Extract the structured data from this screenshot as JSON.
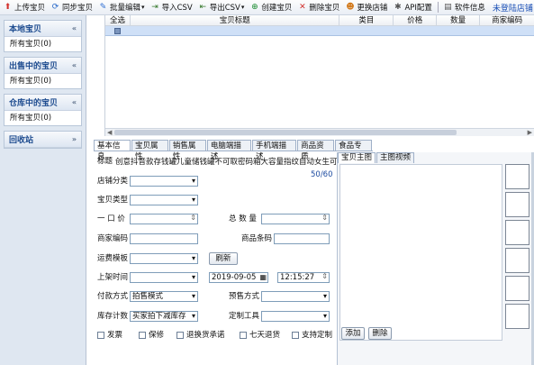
{
  "toolbar": {
    "buttons": [
      {
        "label": "上传宝贝",
        "icon": "upload-arrow-icon"
      },
      {
        "label": "同步宝贝",
        "icon": "sync-icon"
      },
      {
        "label": "批量编辑",
        "icon": "pencil-icon"
      },
      {
        "label": "导入CSV",
        "icon": "import-icon"
      },
      {
        "label": "导出CSV",
        "icon": "export-icon"
      },
      {
        "label": "创建宝贝",
        "icon": "plus-icon"
      },
      {
        "label": "删除宝贝",
        "icon": "delete-x-icon"
      },
      {
        "label": "更换店铺",
        "icon": "user-icon"
      },
      {
        "label": "API配置",
        "icon": "wrench-icon"
      },
      {
        "label": "软件信息",
        "icon": "info-icon"
      }
    ],
    "status": "未登陆店铺"
  },
  "sidebar": {
    "groups": [
      {
        "title": "本地宝贝",
        "items": [
          "所有宝贝(0)"
        ]
      },
      {
        "title": "出售中的宝贝",
        "items": [
          "所有宝贝(0)"
        ]
      },
      {
        "title": "仓库中的宝贝",
        "items": [
          "所有宝贝(0)"
        ]
      },
      {
        "title": "回收站",
        "items": []
      }
    ]
  },
  "grid": {
    "columns": [
      "全选",
      "宝贝标题",
      "类目",
      "价格",
      "数量",
      "商家编码"
    ]
  },
  "tabs": [
    "基本信息",
    "宝贝属性",
    "销售属性",
    "电脑端描述",
    "手机端描述",
    "商品资质",
    "食品专项"
  ],
  "form": {
    "title_label": "标题",
    "title_value": "创意抖音款存钱罐儿童储钱罐不可取密码箱大容量指纹自动女生可爱",
    "title_count": "50/60",
    "shop_category_label": "店铺分类",
    "item_type_label": "宝贝类型",
    "price_label": "一 口 价",
    "total_qty_label": "总 数 量",
    "merchant_code_label": "商家编码",
    "barcode_label": "商品条码",
    "shipping_template_label": "运费模板",
    "refresh_button": "刷新",
    "listing_time_label": "上架时间",
    "listing_date": "2019-09-05",
    "listing_clock": "12:15:27",
    "payment_label": "付款方式",
    "payment_value": "拍售模式",
    "presale_label": "预售方式",
    "stock_count_label": "库存计数",
    "stock_count_value": "买家拍下减库存",
    "custom_tool_label": "定制工具",
    "checkboxes": [
      "发票",
      "保修",
      "退换货承诺",
      "七天退货",
      "支持定制"
    ]
  },
  "image_panel": {
    "tabs": [
      "宝贝主图",
      "主图视频"
    ],
    "add_button": "添加",
    "delete_button": "删除"
  }
}
